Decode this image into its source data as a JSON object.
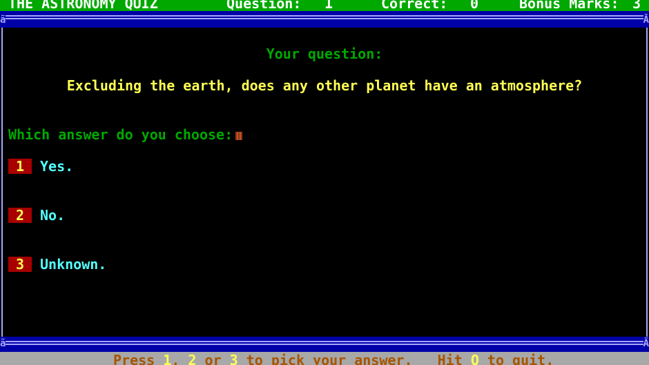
{
  "header": {
    "title": "THE ASTRONOMY QUIZ",
    "question_label": "Question:",
    "question_number": "1",
    "correct_label": "Correct:",
    "correct_count": "0",
    "bonus_label": "Bonus Marks:",
    "bonus_count": "3"
  },
  "frame": {
    "corner_top_left": "ã",
    "corner_top_right": "Ã",
    "corner_bottom_left": "ã",
    "corner_bottom_right": "Ã"
  },
  "main": {
    "heading": "Your question:",
    "question": "Excluding the earth, does any other planet have an atmosphere?",
    "prompt": "Which answer do you choose:"
  },
  "answers": [
    {
      "key": "1",
      "label": "Yes."
    },
    {
      "key": "2",
      "label": "No."
    },
    {
      "key": "3",
      "label": "Unknown."
    }
  ],
  "status": {
    "part1": "Press ",
    "key1": "1",
    "part2": ", ",
    "key2": "2",
    "part3": " or ",
    "key3": "3",
    "part4": " to pick your answer.   Hit ",
    "key4": "Q",
    "part5": " to quit."
  },
  "colors": {
    "header_bg": "#00a800",
    "frame": "#0000a8",
    "heading": "#00a800",
    "question": "#ffff54",
    "answer_text": "#54ffff",
    "answer_key_bg": "#a80000",
    "status_bg": "#a8a8a8",
    "status_text": "#a85400"
  }
}
